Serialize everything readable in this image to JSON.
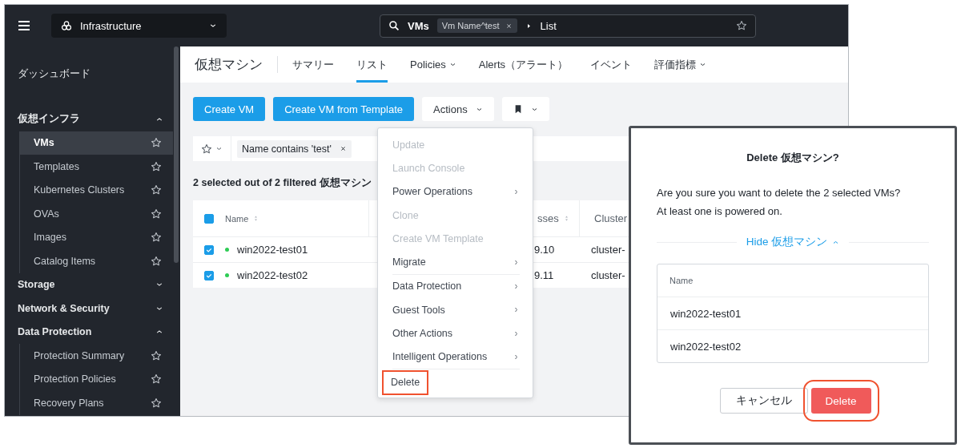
{
  "topbar": {
    "app_selector": "Infrastructure",
    "search": {
      "entity": "VMs",
      "chip": "Vm Name^test",
      "page": "List"
    }
  },
  "sidebar": {
    "items": [
      {
        "label": "ダッシュボード",
        "kind": "link"
      },
      {
        "label": "仮想インフラ",
        "kind": "group",
        "expanded": true,
        "children": [
          {
            "label": "VMs",
            "selected": true
          },
          {
            "label": "Templates",
            "selected": false
          },
          {
            "label": "Kubernetes Clusters",
            "selected": false
          },
          {
            "label": "OVAs",
            "selected": false
          },
          {
            "label": "Images",
            "selected": false
          },
          {
            "label": "Catalog Items",
            "selected": false
          }
        ]
      },
      {
        "label": "Storage",
        "kind": "group",
        "expanded": false
      },
      {
        "label": "Network & Security",
        "kind": "group",
        "expanded": false
      },
      {
        "label": "Data Protection",
        "kind": "group",
        "expanded": true,
        "children": [
          {
            "label": "Protection Summary",
            "selected": false
          },
          {
            "label": "Protection Policies",
            "selected": false
          },
          {
            "label": "Recovery Plans",
            "selected": false
          }
        ]
      }
    ]
  },
  "page": {
    "title": "仮想マシン",
    "tabs": [
      {
        "label": "サマリー",
        "selected": false,
        "has_menu": false
      },
      {
        "label": "リスト",
        "selected": true,
        "has_menu": false
      },
      {
        "label": "Policies",
        "selected": false,
        "has_menu": true
      },
      {
        "label": "Alerts（アラート）",
        "selected": false,
        "has_menu": false
      },
      {
        "label": "イベント",
        "selected": false,
        "has_menu": false
      },
      {
        "label": "評価指標",
        "selected": false,
        "has_menu": true
      }
    ]
  },
  "toolbar": [
    {
      "kind": "primary",
      "label": "Create VM"
    },
    {
      "kind": "primary",
      "label": "Create VM from Template"
    },
    {
      "kind": "menu",
      "label": "Actions"
    },
    {
      "kind": "bookmark"
    }
  ],
  "filter": {
    "chip": "Name contains 'test'"
  },
  "summary": "2 selected out of 2 filtered 仮想マシン",
  "table": {
    "select_all_checked": true,
    "columns": [
      {
        "label": "Name"
      },
      {
        "label": "sses"
      },
      {
        "label": "Cluster"
      }
    ],
    "rows": [
      {
        "checked": true,
        "color": "#2ecc55",
        "name": "win2022-test01",
        "column_2": "9.10",
        "cluster": "cluster-"
      },
      {
        "checked": true,
        "color": "#2ecc55",
        "name": "win2022-test02",
        "column_2": "9.11",
        "cluster": "cluster-"
      }
    ]
  },
  "actions_menu": [
    {
      "label": "Update",
      "disabled": true,
      "has_submenu": false,
      "highlighted": false
    },
    {
      "label": "Launch Console",
      "disabled": true,
      "has_submenu": false,
      "highlighted": false
    },
    {
      "label": "Power Operations",
      "disabled": false,
      "has_submenu": true,
      "highlighted": false
    },
    {
      "label": "Clone",
      "disabled": true,
      "has_submenu": false,
      "highlighted": false
    },
    {
      "label": "Create VM Template",
      "disabled": true,
      "has_submenu": false,
      "highlighted": false
    },
    {
      "label": "Migrate",
      "disabled": false,
      "has_submenu": true,
      "highlighted": false,
      "divider_after": true
    },
    {
      "label": "Data Protection",
      "disabled": false,
      "has_submenu": true,
      "highlighted": false
    },
    {
      "label": "Guest Tools",
      "disabled": false,
      "has_submenu": true,
      "highlighted": false
    },
    {
      "label": "Other Actions",
      "disabled": false,
      "has_submenu": true,
      "highlighted": false
    },
    {
      "label": "Intelligent Operations",
      "disabled": false,
      "has_submenu": true,
      "highlighted": false,
      "divider_after": true
    },
    {
      "label": "Delete",
      "disabled": false,
      "has_submenu": false,
      "highlighted": true
    }
  ],
  "dialog": {
    "title": "Delete 仮想マシン?",
    "message": [
      "Are you sure you want to delete the 2 selected VMs?",
      "At least one is powered on."
    ],
    "toggle": {
      "label": "Hide 仮想マシン",
      "expanded": true
    },
    "list": {
      "header": "Name",
      "rows": [
        "win2022-test01",
        "win2022-test02"
      ]
    },
    "buttons": [
      {
        "kind": "cancel",
        "label": "キャンセル",
        "highlighted": false
      },
      {
        "kind": "danger",
        "label": "Delete",
        "highlighted": true
      }
    ]
  }
}
